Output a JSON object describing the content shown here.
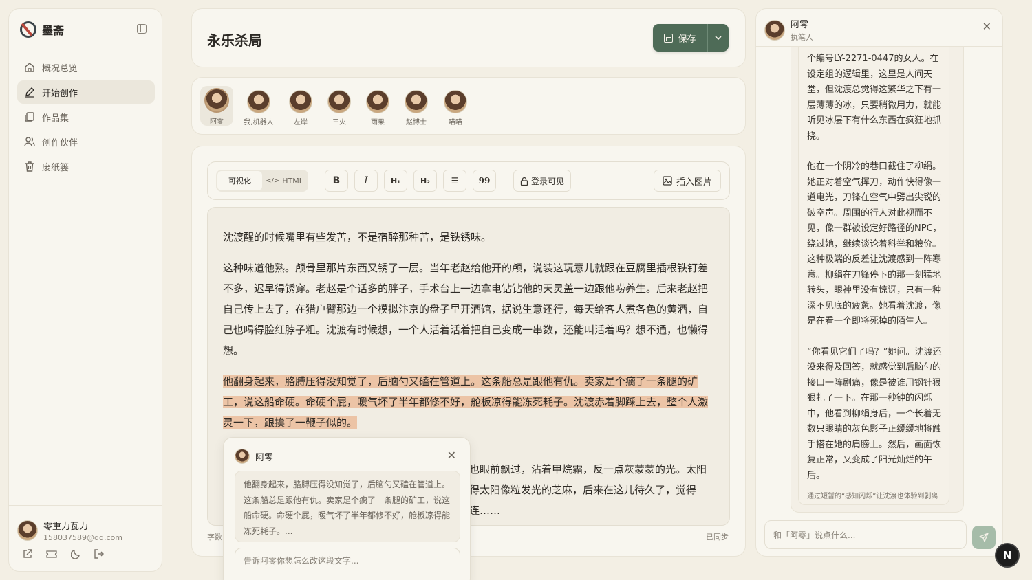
{
  "app": {
    "name": "墨斋"
  },
  "sidebar": {
    "items": [
      {
        "label": "概况总览",
        "icon": "home-icon"
      },
      {
        "label": "开始创作",
        "icon": "pen-icon",
        "active": true
      },
      {
        "label": "作品集",
        "icon": "collection-icon"
      },
      {
        "label": "创作伙伴",
        "icon": "users-icon"
      },
      {
        "label": "废纸篓",
        "icon": "trash-icon"
      }
    ],
    "user": {
      "name": "零重力瓦力",
      "email": "158037589@qq.com"
    }
  },
  "header": {
    "title": "永乐杀局",
    "save_label": "保存"
  },
  "characters": [
    {
      "name": "阿零",
      "selected": true
    },
    {
      "name": "我,机器人"
    },
    {
      "name": "左岸"
    },
    {
      "name": "三火"
    },
    {
      "name": "雨果"
    },
    {
      "name": "赵博士"
    },
    {
      "name": "喵喵"
    }
  ],
  "toolbar": {
    "visual_label": "可视化",
    "html_label": "HTML",
    "bold": "B",
    "italic": "I",
    "h1": "H₁",
    "h2": "H₂",
    "list": "☰",
    "quote": "99",
    "login_label": "登录可见",
    "insert_image_label": "插入图片"
  },
  "editor": {
    "paragraphs": [
      "沈渡醒的时候嘴里有些发苦，不是宿醉那种苦，是铁锈味。",
      "这种味道他熟。颅骨里那片东西又锈了一层。当年老赵给他开的颅，说装这玩意儿就跟在豆腐里插根铁钉差不多，迟早得锈穿。老赵是个话多的胖子，手术台上一边拿电钻钻他的天灵盖一边跟他唠养生。后来老赵把自己传上去了，在猎户臂那边一个模拟汴京的盘子里开酒馆，据说生意还行，每天给客人煮各色的黄酒，自己也喝得脸红脖子粗。沈渡有时候想，一个人活着活着把自己变成一串数，还能叫活着吗？想不通，也懒得想。",
      "他翻身起来，胳膊压得没知觉了，后脑勺又磕在管道上。这条船总是跟他有仇。卖家是个瘸了一条腿的矿工，说这船命硬。命硬个屁，暖气坏了半年都修不好，舱板凉得能冻死耗子。沈渡赤着脚踩上去，整个人激灵一下，跟挨了一鞭子似的。",
      "也眼前飘过，沾着甲烷霜，反一点灰蒙蒙的光。太阳得太阳像粒发光的芝麻，后来在这儿待久了，觉得连……"
    ],
    "word_count_label": "字数",
    "sync_status": "已同步"
  },
  "popup": {
    "name": "阿零",
    "quote": "他翻身起来，胳膊压得没知觉了，后脑勺又磕在管道上。这条船总是跟他有仇。卖家是个瘸了一条腿的矿工，说这船命硬。命硬个屁，暖气坏了半年都修不好，舱板凉得能冻死耗子。...",
    "placeholder": "告诉阿零你想怎么改这段文字..."
  },
  "chat": {
    "name": "阿零",
    "role": "执笔人",
    "messages": [
      "个编号LY-2271-0447的女人。在设定组的逻辑里，这里是人间天堂，但沈渡总觉得这繁华之下有一层薄薄的冰，只要稍微用力，就能听见冰层下有什么东西在疯狂地抓挠。",
      "他在一个阴冷的巷口截住了柳绢。她正对着空气挥刀，动作快得像一道电光，刀锋在空气中劈出尖锐的破空声。周围的行人对此视而不见，像一群被设定好路径的NPC，绕过她，继续谈论着科举和粮价。这种极端的反差让沈渡感到一阵寒意。柳绢在刀锋停下的那一刻猛地转头，眼神里没有惊讶，只有一种深不见底的疲惫。她看着沈渡，像是在看一个即将死掉的陌生人。",
      "“你看见它们了吗？”她问。沈渡还没来得及回答，就感觉到后脑勺的接口一阵剧痛，像是被谁用钢针狠狠扎了一下。在那一秒钟的闪烁中，他看到柳绢身后，一个长着无数只眼睛的灰色影子正缓缓地将触手搭在她的肩膀上。然后，画面恢复正常，又变成了阳光灿烂的午后。"
    ],
    "note": "通过短暂的“感知闪烁”让沈渡也体验到剥离的恐怖，增加剧情的紧迫感。",
    "input_placeholder": "和「阿零」说点什么..."
  },
  "fab": {
    "label": "N"
  }
}
